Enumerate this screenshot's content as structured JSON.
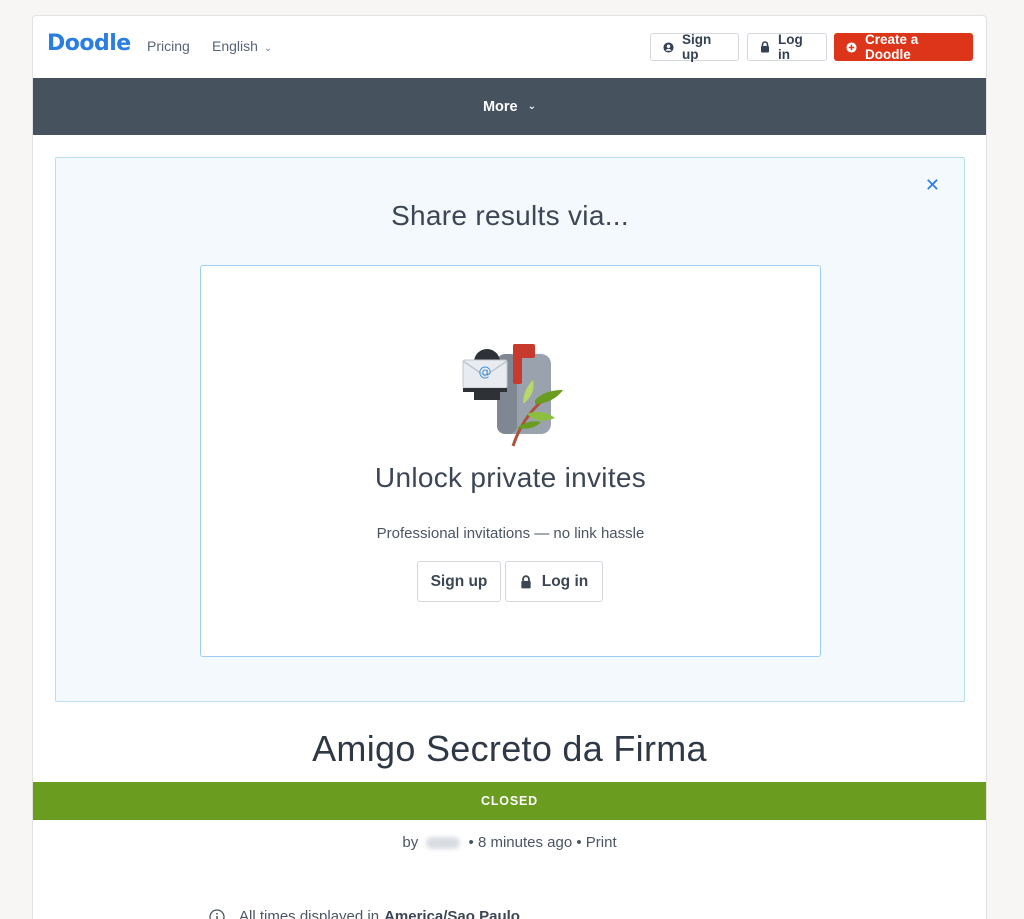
{
  "header": {
    "logo": "Doodle",
    "pricing": "Pricing",
    "language": "English",
    "signup": "Sign up",
    "login": "Log in",
    "create": "Create a Doodle"
  },
  "morebar": {
    "more": "More"
  },
  "share": {
    "title": "Share results via...",
    "unlock_title": "Unlock private invites",
    "unlock_subtitle": "Professional invitations — no link hassle",
    "signup": "Sign up",
    "login": "Log in"
  },
  "poll": {
    "title": "Amigo Secreto da Firma",
    "status": "CLOSED",
    "by_prefix": "by",
    "time_ago": "• 8 minutes ago •",
    "print": "Print",
    "timezone_prefix": "All times displayed in",
    "timezone": "America/Sao Paulo"
  },
  "colors": {
    "brand": "#2a7de1",
    "create_button": "#dc3519",
    "dark_bar": "#47525f",
    "closed": "#6a9c1f"
  },
  "icons": [
    "user-icon",
    "lock-icon",
    "plus-circle-icon",
    "chevron-down-icon",
    "close-icon",
    "mailbox-illustration",
    "info-icon"
  ]
}
